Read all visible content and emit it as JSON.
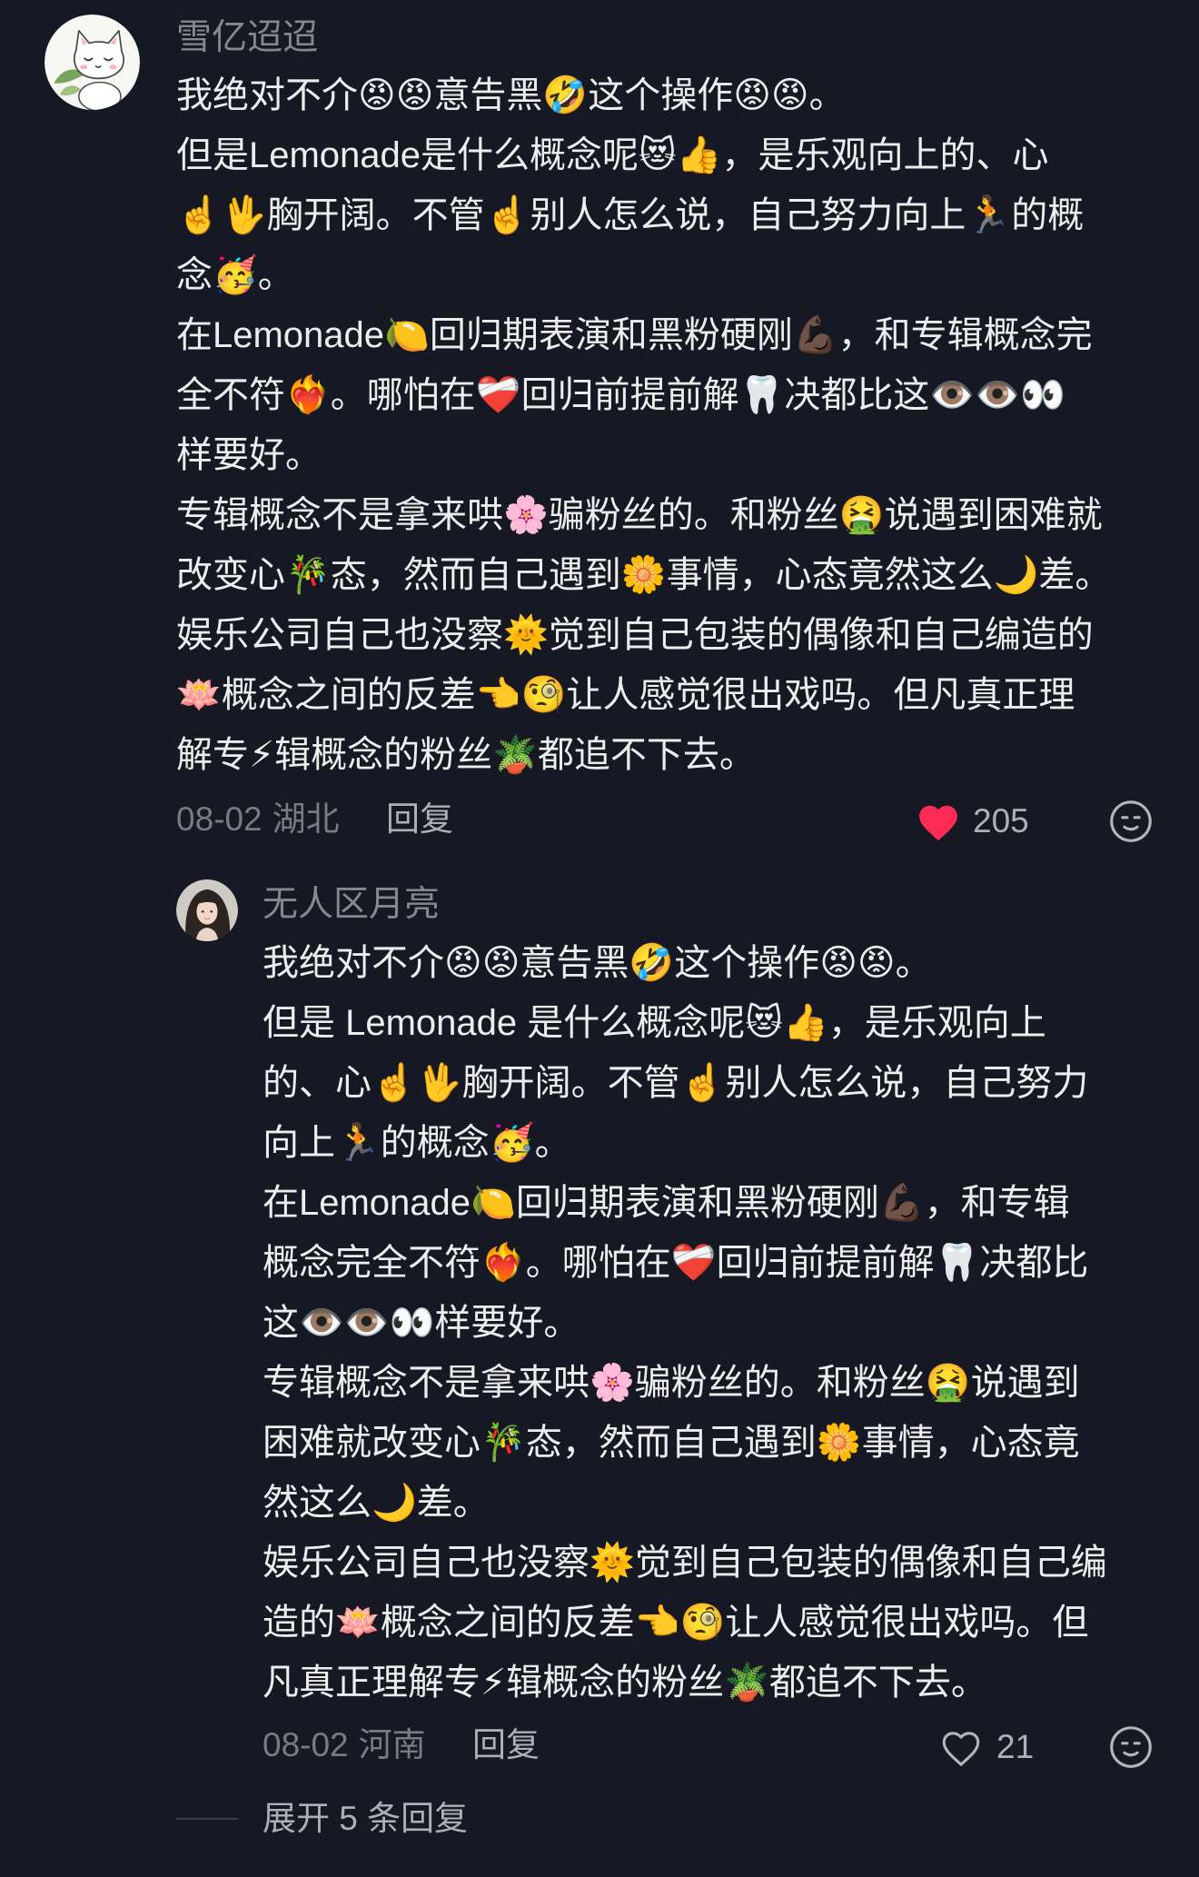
{
  "theme": {
    "background": "#161823",
    "text": "#ededed",
    "username": "#87878e",
    "meta": "#7a7a81",
    "action": "#afafb5",
    "like_active": "#fe2c55",
    "divider": "#3a3b45"
  },
  "comment": {
    "username": "雪亿迢迢",
    "text_lines": [
      "我绝对不介😡😡意告黑🤣这个操作😡😡。",
      "但是Lemonade是什么概念呢😻👍，是乐观向上的、心",
      "☝️🖖胸开阔。不管☝️别人怎么说，自己努力向上🏃的概",
      "念🥳。",
      "在Lemonade🍋回归期表演和黑粉硬刚💪🏿，和专辑概念完",
      "全不符❤️‍🔥。哪怕在❤️‍🩹回归前提前解🦷决都比这👁️👁️👀",
      "样要好。",
      "专辑概念不是拿来哄🌸骗粉丝的。和粉丝🤮说遇到困难就",
      "改变心🎋态，然而自己遇到🌼事情，心态竟然这么🌙差。",
      "娱乐公司自己也没察🌞觉到自己包装的偶像和自己编造的",
      "🪷概念之间的反差👈🧐让人感觉很出戏吗。但凡真正理",
      "解专⚡辑概念的粉丝🪴都追不下去。"
    ],
    "date": "08-02",
    "location": "湖北",
    "reply_label": "回复",
    "like_count": "205",
    "liked": true,
    "like_icon": "heart-filled-icon",
    "react_icon": "emoji-reaction-icon"
  },
  "reply": {
    "username": "无人区月亮",
    "text_lines": [
      "我绝对不介😡😡意告黑🤣这个操作😡😡。",
      "但是 Lemonade 是什么概念呢😻👍，是乐观向上",
      "的、心☝️🖖胸开阔。不管☝️别人怎么说，自己努力",
      "向上🏃的概念🥳。",
      "在Lemonade🍋回归期表演和黑粉硬刚💪🏿，和专辑",
      "概念完全不符❤️‍🔥。哪怕在❤️‍🩹回归前提前解🦷决都比",
      "这👁️👁️👀样要好。",
      "专辑概念不是拿来哄🌸骗粉丝的。和粉丝🤮说遇到",
      "困难就改变心🎋态，然而自己遇到🌼事情，心态竟",
      "然这么🌙差。",
      "娱乐公司自己也没察🌞觉到自己包装的偶像和自己编",
      "造的🪷概念之间的反差👈🧐让人感觉很出戏吗。但",
      "凡真正理解专⚡辑概念的粉丝🪴都追不下去。"
    ],
    "date": "08-02",
    "location": "河南",
    "reply_label": "回复",
    "like_count": "21",
    "liked": false,
    "like_icon": "heart-outline-icon",
    "react_icon": "emoji-reaction-icon"
  },
  "footer": {
    "expand_replies_label": "展开 5 条回复"
  }
}
